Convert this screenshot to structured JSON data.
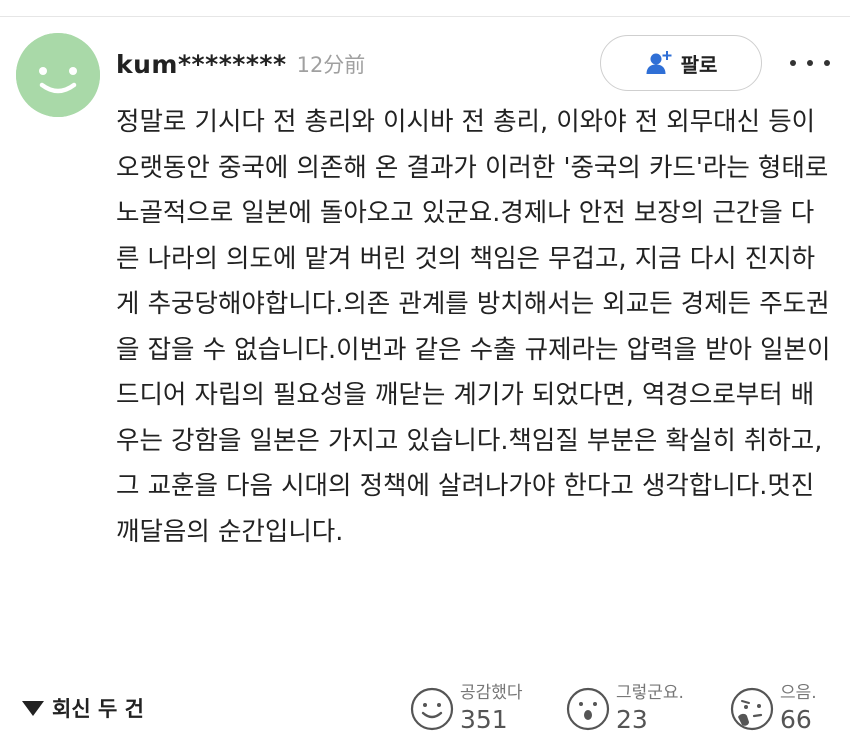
{
  "comment": {
    "username": "kum********",
    "timestamp": "12分前",
    "follow_label": "팔로",
    "avatar_icon": "smiley-avatar-icon",
    "avatar_color": "#a9d9a8",
    "body": "정말로 기시다 전 총리와 이시바 전 총리, 이와야 전 외무대신 등이 오랫동안 중국에 의존해 온 결과가 이러한 '중국의 카드'라는 형태로 노골적으로 일본에 돌아오고 있군요.경제나 안전 보장의 근간을 다른 나라의 의도에 맡겨 버린 것의 책임은 무겁고, 지금 다시 진지하게 추궁당해야합니다.의존 관계를 방치해서는 외교든 경제든 주도권을 잡을 수 없습니다.이번과 같은 수출 규제라는 압력을 받아 일본이 드디어 자립의 필요성을 깨닫는 계기가 되었다면, 역경으로부터 배우는 강함을 일본은 가지고 있습니다.책임질 부분은 확실히 취하고, 그 교훈을 다음 시대의 정책에 살려나가야 한다고 생각합니다.멋진 깨달음의 순간입니다."
  },
  "footer": {
    "replies_label": "회신 두 건",
    "reactions": [
      {
        "label": "공감했다",
        "count": "351",
        "icon": "smile-face-icon"
      },
      {
        "label": "그렇군요.",
        "count": "23",
        "icon": "surprised-face-icon"
      },
      {
        "label": "으음.",
        "count": "66",
        "icon": "thinking-face-icon"
      }
    ]
  }
}
